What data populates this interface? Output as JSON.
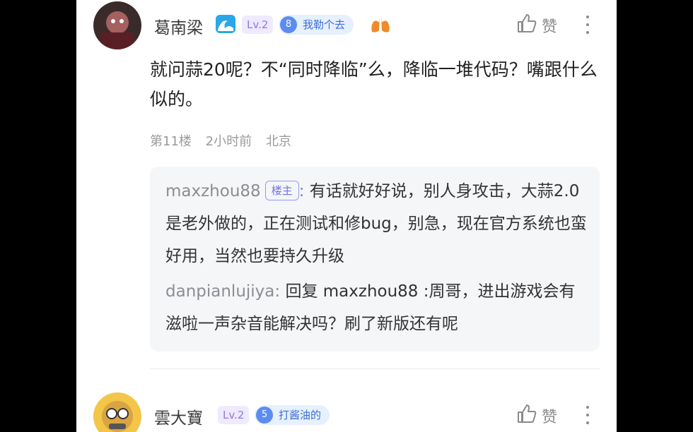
{
  "comments": [
    {
      "username": "葛南梁",
      "level": "Lv.2",
      "fan_level": "8",
      "fan_name": "我勒个去",
      "like_label": "赞",
      "content": "就问蒜20呢？不“同时降临”么，降临一堆代码？嘴跟什么似的。",
      "floor": "第11楼",
      "time": "2小时前",
      "location": "北京"
    },
    {
      "username": "雲大寶",
      "level": "Lv.2",
      "fan_level": "5",
      "fan_name": "打酱油的",
      "like_label": "赞"
    }
  ],
  "replies": [
    {
      "name": "maxzhou88",
      "badge": "楼主",
      "text": "有话就好好说，别人身攻击，大蒜2.0是老外做的，正在测试和修bug，别急，现在官方系统也蛮好用，当然也要持久升级"
    },
    {
      "name": "danpianlujiya",
      "text": "回复 maxzhou88 :周哥，进出游戏会有滋啦一声杂音能解决吗？刷了新版还有呢"
    }
  ],
  "colors": {
    "level_text": "#8e7ae6",
    "fan_badge": "#5b8cf0",
    "host_badge": "#6d75e8"
  }
}
